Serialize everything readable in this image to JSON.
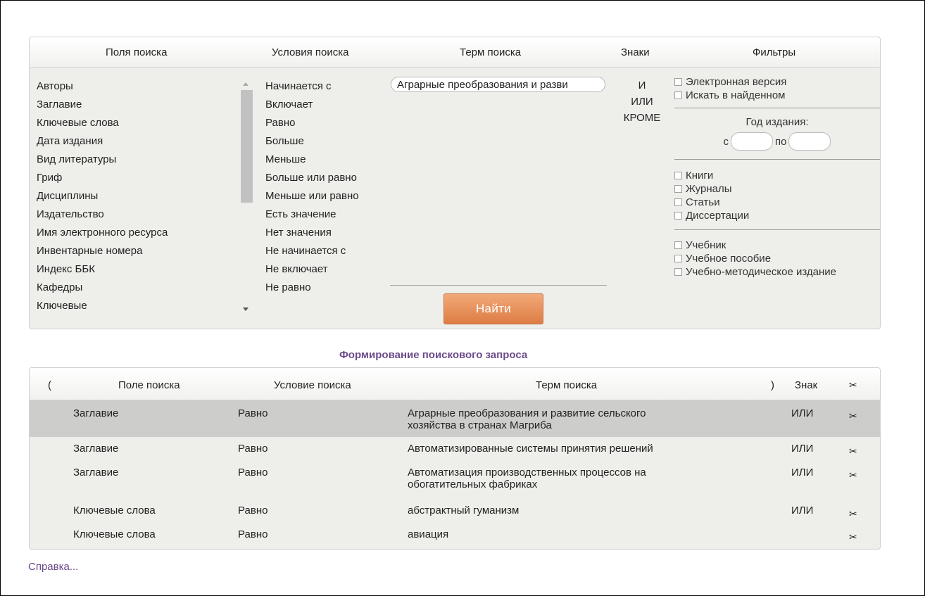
{
  "search_panel": {
    "headers": {
      "fields": "Поля поиска",
      "conditions": "Условия поиска",
      "term": "Терм поиска",
      "signs": "Знаки",
      "filters": "Фильтры"
    },
    "fields": [
      "Авторы",
      "Заглавие",
      "Ключевые слова",
      "Дата издания",
      "Вид литературы",
      "Гриф",
      "Дисциплины",
      "Издательство",
      "Имя электронного ресурса",
      "Инвентарные номера",
      "Индекс ББК",
      "Кафедры",
      "Ключевые"
    ],
    "conditions": [
      "Начинается с",
      "Включает",
      "Равно",
      "Больше",
      "Меньше",
      "Больше или равно",
      "Меньше или равно",
      "Есть значение",
      "Нет значения",
      "Не начинается с",
      "Не включает",
      "Не равно"
    ],
    "term_value": "Аграрные преобразования и разви",
    "find_button": "Найти",
    "signs": [
      "И",
      "ИЛИ",
      "КРОМЕ"
    ],
    "filters": {
      "electronic": "Электронная версия",
      "search_in_found": "Искать в найденном",
      "year_title": "Год издания:",
      "year_from": "с",
      "year_to": "по",
      "types": [
        "Книги",
        "Журналы",
        "Статьи",
        "Диссертации"
      ],
      "purposes": [
        "Учебник",
        "Учебное пособие",
        "Учебно-методическое издание"
      ]
    }
  },
  "query": {
    "title": "Формирование поискового запроса",
    "headers": {
      "open_paren": "(",
      "field": "Поле поиска",
      "condition": "Условие поиска",
      "term": "Терм поиска",
      "close_paren": ")",
      "sign": "Знак"
    },
    "rows": [
      {
        "field": "Заглавие",
        "condition": "Равно",
        "term1": "Аграрные преобразования и развитие сельского",
        "term2": "хозяйства в странах Магриба",
        "sign": "ИЛИ"
      },
      {
        "field": "Заглавие",
        "condition": "Равно",
        "term1": "Автоматизированные системы принятия решений",
        "term2": "",
        "sign": "ИЛИ"
      },
      {
        "field": "Заглавие",
        "condition": "Равно",
        "term1": "Автоматизация производственных процессов на",
        "term2": "обогатительных фабриках",
        "sign": "ИЛИ"
      },
      {
        "field": "Ключевые слова",
        "condition": "Равно",
        "term1": "абстрактный гуманизм",
        "term2": "",
        "sign": "ИЛИ"
      },
      {
        "field": "Ключевые слова",
        "condition": "Равно",
        "term1": "авиация",
        "term2": "",
        "sign": ""
      }
    ]
  },
  "help_link": "Справка...",
  "icons": {
    "scissors": "scissors-icon"
  }
}
